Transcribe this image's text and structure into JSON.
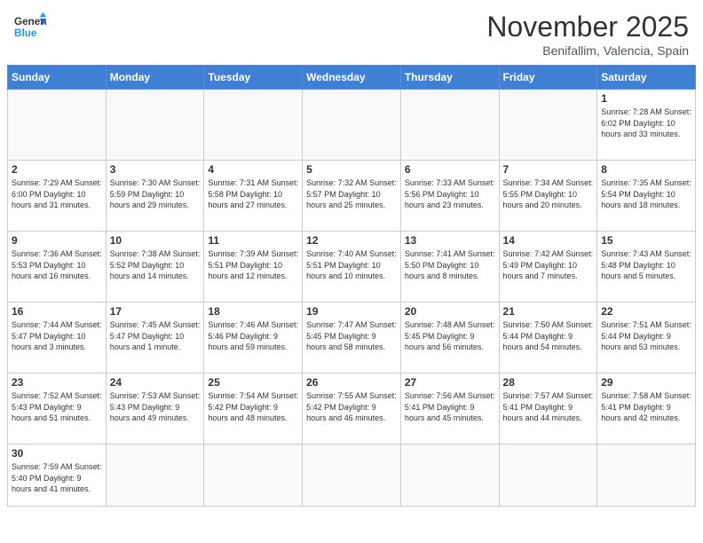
{
  "header": {
    "logo_general": "General",
    "logo_blue": "Blue",
    "month_year": "November 2025",
    "location": "Benifallim, Valencia, Spain"
  },
  "weekdays": [
    "Sunday",
    "Monday",
    "Tuesday",
    "Wednesday",
    "Thursday",
    "Friday",
    "Saturday"
  ],
  "weeks": [
    [
      {
        "day": "",
        "info": ""
      },
      {
        "day": "",
        "info": ""
      },
      {
        "day": "",
        "info": ""
      },
      {
        "day": "",
        "info": ""
      },
      {
        "day": "",
        "info": ""
      },
      {
        "day": "",
        "info": ""
      },
      {
        "day": "1",
        "info": "Sunrise: 7:28 AM\nSunset: 6:02 PM\nDaylight: 10 hours and 33 minutes."
      }
    ],
    [
      {
        "day": "2",
        "info": "Sunrise: 7:29 AM\nSunset: 6:00 PM\nDaylight: 10 hours and 31 minutes."
      },
      {
        "day": "3",
        "info": "Sunrise: 7:30 AM\nSunset: 5:59 PM\nDaylight: 10 hours and 29 minutes."
      },
      {
        "day": "4",
        "info": "Sunrise: 7:31 AM\nSunset: 5:58 PM\nDaylight: 10 hours and 27 minutes."
      },
      {
        "day": "5",
        "info": "Sunrise: 7:32 AM\nSunset: 5:57 PM\nDaylight: 10 hours and 25 minutes."
      },
      {
        "day": "6",
        "info": "Sunrise: 7:33 AM\nSunset: 5:56 PM\nDaylight: 10 hours and 23 minutes."
      },
      {
        "day": "7",
        "info": "Sunrise: 7:34 AM\nSunset: 5:55 PM\nDaylight: 10 hours and 20 minutes."
      },
      {
        "day": "8",
        "info": "Sunrise: 7:35 AM\nSunset: 5:54 PM\nDaylight: 10 hours and 18 minutes."
      }
    ],
    [
      {
        "day": "9",
        "info": "Sunrise: 7:36 AM\nSunset: 5:53 PM\nDaylight: 10 hours and 16 minutes."
      },
      {
        "day": "10",
        "info": "Sunrise: 7:38 AM\nSunset: 5:52 PM\nDaylight: 10 hours and 14 minutes."
      },
      {
        "day": "11",
        "info": "Sunrise: 7:39 AM\nSunset: 5:51 PM\nDaylight: 10 hours and 12 minutes."
      },
      {
        "day": "12",
        "info": "Sunrise: 7:40 AM\nSunset: 5:51 PM\nDaylight: 10 hours and 10 minutes."
      },
      {
        "day": "13",
        "info": "Sunrise: 7:41 AM\nSunset: 5:50 PM\nDaylight: 10 hours and 8 minutes."
      },
      {
        "day": "14",
        "info": "Sunrise: 7:42 AM\nSunset: 5:49 PM\nDaylight: 10 hours and 7 minutes."
      },
      {
        "day": "15",
        "info": "Sunrise: 7:43 AM\nSunset: 5:48 PM\nDaylight: 10 hours and 5 minutes."
      }
    ],
    [
      {
        "day": "16",
        "info": "Sunrise: 7:44 AM\nSunset: 5:47 PM\nDaylight: 10 hours and 3 minutes."
      },
      {
        "day": "17",
        "info": "Sunrise: 7:45 AM\nSunset: 5:47 PM\nDaylight: 10 hours and 1 minute."
      },
      {
        "day": "18",
        "info": "Sunrise: 7:46 AM\nSunset: 5:46 PM\nDaylight: 9 hours and 59 minutes."
      },
      {
        "day": "19",
        "info": "Sunrise: 7:47 AM\nSunset: 5:45 PM\nDaylight: 9 hours and 58 minutes."
      },
      {
        "day": "20",
        "info": "Sunrise: 7:48 AM\nSunset: 5:45 PM\nDaylight: 9 hours and 56 minutes."
      },
      {
        "day": "21",
        "info": "Sunrise: 7:50 AM\nSunset: 5:44 PM\nDaylight: 9 hours and 54 minutes."
      },
      {
        "day": "22",
        "info": "Sunrise: 7:51 AM\nSunset: 5:44 PM\nDaylight: 9 hours and 53 minutes."
      }
    ],
    [
      {
        "day": "23",
        "info": "Sunrise: 7:52 AM\nSunset: 5:43 PM\nDaylight: 9 hours and 51 minutes."
      },
      {
        "day": "24",
        "info": "Sunrise: 7:53 AM\nSunset: 5:43 PM\nDaylight: 9 hours and 49 minutes."
      },
      {
        "day": "25",
        "info": "Sunrise: 7:54 AM\nSunset: 5:42 PM\nDaylight: 9 hours and 48 minutes."
      },
      {
        "day": "26",
        "info": "Sunrise: 7:55 AM\nSunset: 5:42 PM\nDaylight: 9 hours and 46 minutes."
      },
      {
        "day": "27",
        "info": "Sunrise: 7:56 AM\nSunset: 5:41 PM\nDaylight: 9 hours and 45 minutes."
      },
      {
        "day": "28",
        "info": "Sunrise: 7:57 AM\nSunset: 5:41 PM\nDaylight: 9 hours and 44 minutes."
      },
      {
        "day": "29",
        "info": "Sunrise: 7:58 AM\nSunset: 5:41 PM\nDaylight: 9 hours and 42 minutes."
      }
    ],
    [
      {
        "day": "30",
        "info": "Sunrise: 7:59 AM\nSunset: 5:40 PM\nDaylight: 9 hours and 41 minutes."
      },
      {
        "day": "",
        "info": ""
      },
      {
        "day": "",
        "info": ""
      },
      {
        "day": "",
        "info": ""
      },
      {
        "day": "",
        "info": ""
      },
      {
        "day": "",
        "info": ""
      },
      {
        "day": "",
        "info": ""
      }
    ]
  ]
}
